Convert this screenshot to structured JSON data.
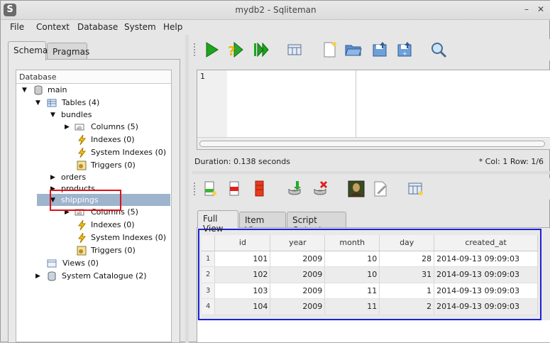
{
  "window": {
    "title": "mydb2 - Sqliteman",
    "app_icon": "S"
  },
  "menu": [
    "File",
    "Context",
    "Database",
    "System",
    "Help"
  ],
  "left_tabs": [
    "Schema",
    "Pragmas"
  ],
  "tree": {
    "header": "Database",
    "items": [
      {
        "label": "main",
        "icon": "database-icon",
        "arrow": "down"
      },
      {
        "label": "Tables (4)",
        "icon": "table-icon",
        "arrow": "down"
      },
      {
        "label": "bundles",
        "icon": "",
        "arrow": "down"
      },
      {
        "label": "Columns (5)",
        "icon": "columns-icon",
        "arrow": "right"
      },
      {
        "label": "Indexes (0)",
        "icon": "lightning-icon",
        "arrow": ""
      },
      {
        "label": "System Indexes (0)",
        "icon": "lightning-icon",
        "arrow": ""
      },
      {
        "label": "Triggers (0)",
        "icon": "trigger-icon",
        "arrow": ""
      },
      {
        "label": "orders",
        "icon": "",
        "arrow": "right"
      },
      {
        "label": "products",
        "icon": "",
        "arrow": "right"
      },
      {
        "label": "shippings",
        "icon": "",
        "arrow": "down"
      },
      {
        "label": "Columns (5)",
        "icon": "columns-icon",
        "arrow": "right"
      },
      {
        "label": "Indexes (0)",
        "icon": "lightning-icon",
        "arrow": ""
      },
      {
        "label": "System Indexes (0)",
        "icon": "lightning-icon",
        "arrow": ""
      },
      {
        "label": "Triggers (0)",
        "icon": "trigger-icon",
        "arrow": ""
      },
      {
        "label": "Views (0)",
        "icon": "view-icon",
        "arrow": ""
      },
      {
        "label": "System Catalogue (2)",
        "icon": "catalogue-icon",
        "arrow": "right"
      }
    ]
  },
  "editor": {
    "line_number": "1"
  },
  "status": {
    "duration": "Duration: 0.138 seconds",
    "position": "*  Col: 1 Row: 1/6"
  },
  "result_tabs": [
    "Full View",
    "Item View",
    "Script Output"
  ],
  "grid": {
    "columns": [
      "id",
      "year",
      "month",
      "day",
      "created_at"
    ],
    "rows": [
      {
        "n": "1",
        "cells": [
          "101",
          "2009",
          "10",
          "28",
          "2014-09-13 09:09:03"
        ]
      },
      {
        "n": "2",
        "cells": [
          "102",
          "2009",
          "10",
          "31",
          "2014-09-13 09:09:03"
        ]
      },
      {
        "n": "3",
        "cells": [
          "103",
          "2009",
          "11",
          "1",
          "2014-09-13 09:09:03"
        ]
      },
      {
        "n": "4",
        "cells": [
          "104",
          "2009",
          "11",
          "2",
          "2014-09-13 09:09:03"
        ]
      }
    ]
  },
  "colors": {
    "highlight_red": "#e0101a",
    "highlight_blue": "#1c22d6",
    "selection": "#9db4cc"
  }
}
